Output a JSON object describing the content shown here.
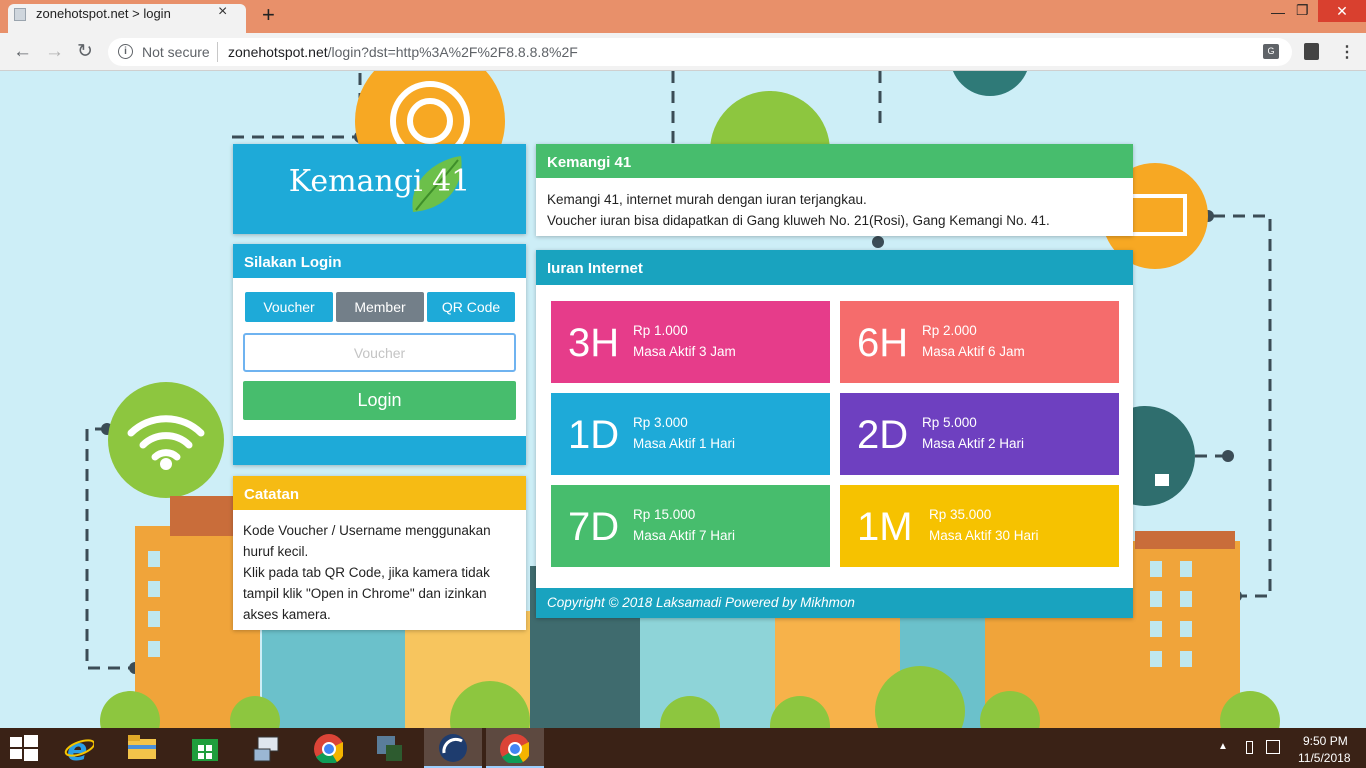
{
  "browser": {
    "tab_title": "zonehotspot.net > login",
    "tab_close": "×",
    "new_tab": "+",
    "security_label": "Not secure",
    "url_host": "zonehotspot.net",
    "url_path": "/login?dst=http%3A%2F%2F8.8.8.8%2F",
    "nav": {
      "back": "←",
      "forward": "→",
      "reload": "↻"
    },
    "window": {
      "minimize": "—",
      "maximize": "❐",
      "close": "✕"
    },
    "menu": "⋮"
  },
  "logo": {
    "text": "Kemangi 41"
  },
  "login": {
    "title": "Silakan Login",
    "tabs": [
      {
        "label": "Voucher",
        "color": "#1eaad8"
      },
      {
        "label": "Member",
        "color": "#737f89"
      },
      {
        "label": "QR Code",
        "color": "#1eaad8"
      }
    ],
    "input_placeholder": "Voucher",
    "input_value": "",
    "button_label": "Login"
  },
  "notes": {
    "title": "Catatan",
    "lines": [
      "Kode Voucher / Username menggunakan huruf kecil.",
      "Klik pada tab QR Code, jika kamera tidak tampil klik \"Open in Chrome\" dan izinkan akses kamera."
    ]
  },
  "info": {
    "title": "Kemangi 41",
    "lines": [
      "Kemangi 41, internet murah dengan iuran terjangkau.",
      "Voucher iuran bisa didapatkan di Gang kluweh No. 21(Rosi), Gang Kemangi No. 41."
    ]
  },
  "rates": {
    "title": "Iuran Internet",
    "plans": [
      {
        "code": "3H",
        "price": "Rp 1.000",
        "desc": "Masa Aktif 3 Jam",
        "color": "#e63c8a"
      },
      {
        "code": "6H",
        "price": "Rp 2.000",
        "desc": "Masa Aktif 6 Jam",
        "color": "#f56c6c"
      },
      {
        "code": "1D",
        "price": "Rp 3.000",
        "desc": "Masa Aktif 1 Hari",
        "color": "#1eaad8"
      },
      {
        "code": "2D",
        "price": "Rp 5.000",
        "desc": "Masa Aktif 2 Hari",
        "color": "#6e40c0"
      },
      {
        "code": "7D",
        "price": "Rp 15.000",
        "desc": "Masa Aktif 7 Hari",
        "color": "#47bd6d"
      },
      {
        "code": "1M",
        "price": "Rp 35.000",
        "desc": "Masa Aktif 30 Hari",
        "color": "#f6c200"
      }
    ],
    "copyright": "Copyright © 2018 Laksamadi Powered by Mikhmon"
  },
  "taskbar": {
    "apps": [
      "windows-start-icon",
      "internet-explorer-icon",
      "file-explorer-icon",
      "store-icon",
      "network-tool-icon",
      "chrome-icon",
      "remote-tool-icon",
      "winbox-icon",
      "chrome-active-icon"
    ],
    "time": "9:50 PM",
    "date": "11/5/2018",
    "tray_arrow": "▲"
  }
}
